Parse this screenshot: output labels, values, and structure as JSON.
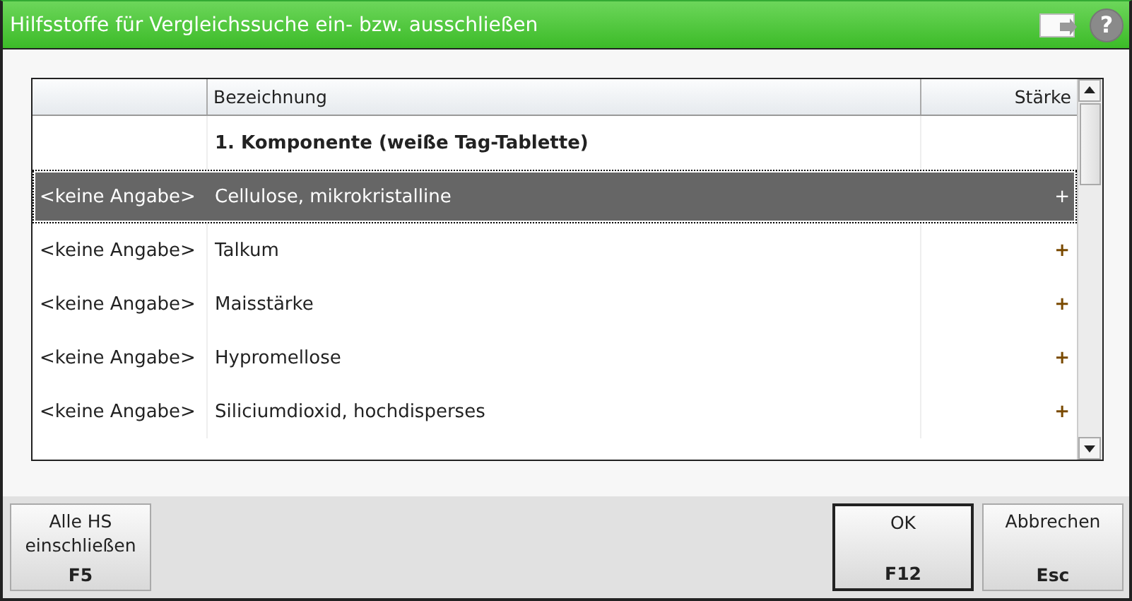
{
  "window": {
    "title": "Hilfsstoffe für Vergleichssuche ein- bzw. ausschließen",
    "help": "?"
  },
  "table": {
    "columns": [
      "",
      "Bezeichnung",
      "Stärke"
    ],
    "rows": [
      {
        "kind": "group",
        "label": "1. Komponente (weiße Tag-Tablette)",
        "selected": false
      },
      {
        "kind": "item",
        "info": "<keine Angabe>",
        "name": "Cellulose, mikrokristalline",
        "strength": "+",
        "selected": true
      },
      {
        "kind": "item",
        "info": "<keine Angabe>",
        "name": "Talkum",
        "strength": "+",
        "selected": false
      },
      {
        "kind": "item",
        "info": "<keine Angabe>",
        "name": "Maisstärke",
        "strength": "+",
        "selected": false
      },
      {
        "kind": "item",
        "info": "<keine Angabe>",
        "name": "Hypromellose",
        "strength": "+",
        "selected": false
      },
      {
        "kind": "item",
        "info": "<keine Angabe>",
        "name": "Siliciumdioxid, hochdisperses",
        "strength": "+",
        "selected": false
      }
    ]
  },
  "left_buttons": [
    {
      "lines": [
        "Alle HS",
        "einschließen"
      ],
      "key": "F5",
      "default": false
    }
  ],
  "right_buttons": [
    {
      "lines": [
        "OK"
      ],
      "key": "F12",
      "default": true
    },
    {
      "lines": [
        "Abbrechen"
      ],
      "key": "Esc",
      "default": false
    }
  ]
}
